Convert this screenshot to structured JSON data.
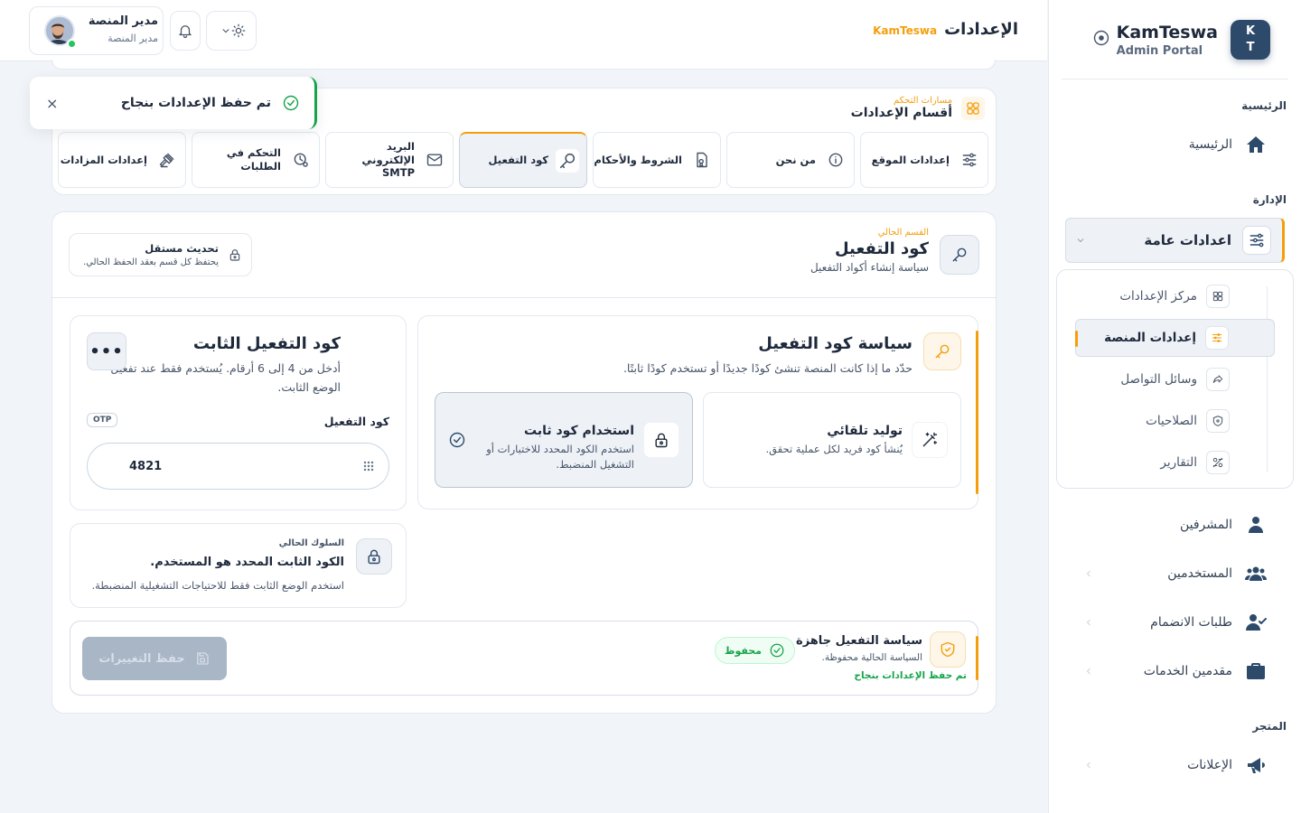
{
  "brand": {
    "logo_top": "K",
    "logo_bottom": "T",
    "name": "KamTeswa",
    "subtitle": "Admin Portal"
  },
  "sidebar": {
    "section_main": "الرئيسية",
    "home": "الرئيسية",
    "section_admin": "الإدارة",
    "general_settings": "اعدادات عامة",
    "submenu": [
      {
        "label": "مركز الإعدادات",
        "icon": "grid-icon"
      },
      {
        "label": "إعدادات المنصة",
        "icon": "sliders-icon"
      },
      {
        "label": "وسائل التواصل",
        "icon": "share-icon"
      },
      {
        "label": "الصلاحيات",
        "icon": "shield-icon"
      },
      {
        "label": "التقارير",
        "icon": "reports-icon"
      }
    ],
    "supervisors": "المشرفين",
    "users": "المستخدمين",
    "join_requests": "طلبات الانضمام",
    "providers": "مقدمين الخدمات",
    "section_store": "المتجر",
    "ads": "الإعلانات"
  },
  "header": {
    "title": "الإعدادات",
    "brand_tag": "KamTeswa",
    "user_name": "مدير المنصة",
    "user_role": "مدير المنصة"
  },
  "toast": {
    "message": "تم حفظ الإعدادات بنجاح",
    "close": "×"
  },
  "sections": {
    "eyebrow": "مسارات التحكم",
    "title": "أقسام الإعدادات",
    "tabs": [
      {
        "label": "إعدادات الموقع",
        "icon": "sliders-icon"
      },
      {
        "label": "من نحن",
        "icon": "info-icon"
      },
      {
        "label": "الشروط والأحكام",
        "icon": "document-icon"
      },
      {
        "label": "كود التفعيل",
        "icon": "key-icon"
      },
      {
        "label": "البريد الإلكتروني SMTP",
        "icon": "mail-icon"
      },
      {
        "label": "التحكم في الطلبات",
        "icon": "clock-settings-icon"
      },
      {
        "label": "إعدادات المزادات",
        "icon": "gavel-icon"
      }
    ]
  },
  "main": {
    "eyebrow": "القسم الحالي",
    "title": "كود التفعيل",
    "subtitle": "سياسة إنشاء أكواد التفعيل",
    "indep_title": "تحديث مستقل",
    "indep_sub": "يحتفظ كل قسم بعقد الحفظ الحالي."
  },
  "policy": {
    "title": "سياسة كود التفعيل",
    "subtitle": "حدّد ما إذا كانت المنصة تنشئ كودًا جديدًا أو تستخدم كودًا ثابتًا.",
    "auto_title": "توليد تلقائي",
    "auto_desc": "يُنشأ كود فريد لكل عملية تحقق.",
    "fixed_title": "استخدام كود ثابت",
    "fixed_desc": "استخدم الكود المحدد للاختبارات أو التشغيل المنضبط."
  },
  "fixed_code": {
    "title": "كود التفعيل الثابت",
    "subtitle": "أدخل من 4 إلى 6 أرقام. يُستخدم فقط عند تفعيل الوضع الثابت.",
    "more": "•••",
    "field_label": "كود التفعيل",
    "badge": "OTP",
    "value": "4821"
  },
  "behavior": {
    "eyebrow": "السلوك الحالي",
    "title": "الكود الثابت المحدد هو المستخدم.",
    "desc": "استخدم الوضع الثابت فقط للاحتياجات التشغيلية المنضبطة."
  },
  "footer": {
    "title": "سياسة التفعيل جاهزة",
    "subtitle": "السياسة الحالية محفوظة.",
    "success": "تم حفظ الإعدادات بنجاح",
    "badge": "محفوظ",
    "save": "حفظ التغييرات"
  },
  "colors": {
    "accent": "#f59e0b",
    "primary": "#2d4a6b",
    "success": "#16a34a"
  }
}
